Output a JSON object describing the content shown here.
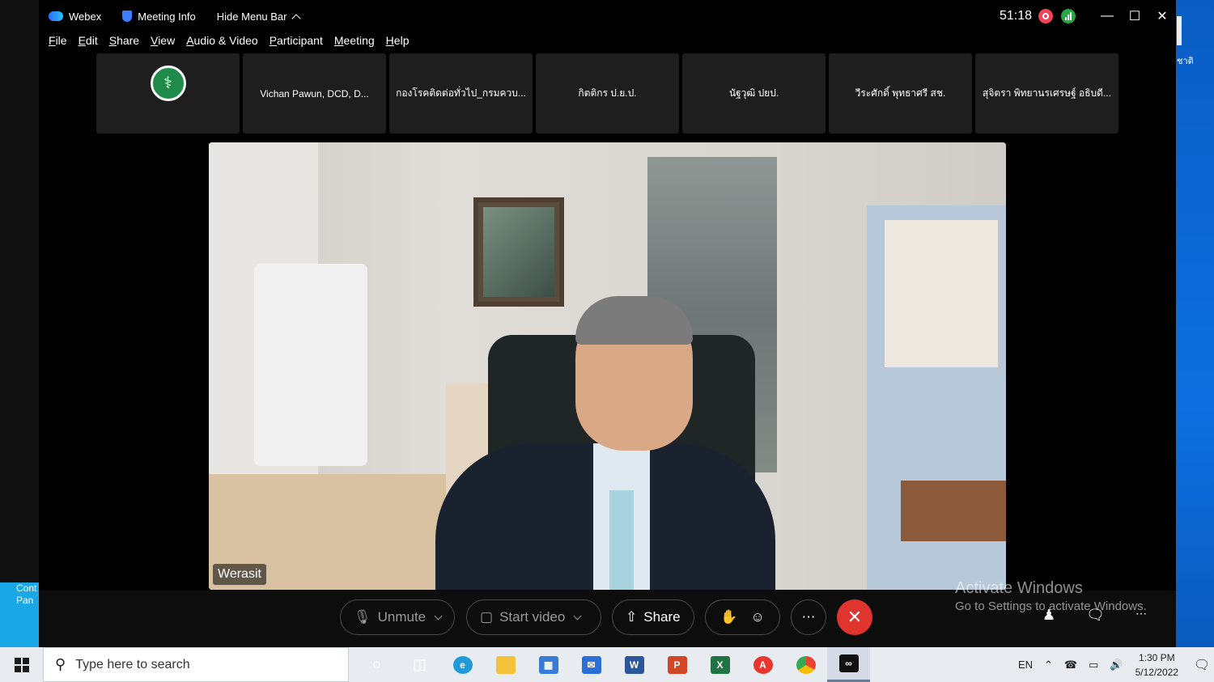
{
  "titlebar": {
    "app_name": "Webex",
    "meeting_info": "Meeting Info",
    "hide_menu": "Hide Menu Bar",
    "timer": "51:18"
  },
  "menu": [
    "File",
    "Edit",
    "Share",
    "View",
    "Audio & Video",
    "Participant",
    "Meeting",
    "Help"
  ],
  "participants": [
    "Vichan Pawun, DCD, D...",
    "กองโรคติดต่อทั่วไป_กรมควบ...",
    "กิตติกร ป.ย.ป.",
    "นัฐวุฒิ ปยป.",
    "วีระศักดิ์ พุทธาศรี สช.",
    "สุจิตรา พิทยานรเศรษฐ์ อธิบดี..."
  ],
  "active_speaker": "Werasit",
  "controls": {
    "unmute": "Unmute",
    "start_video": "Start video",
    "share": "Share"
  },
  "watermark": {
    "line1": "Activate Windows",
    "line2": "Go to Settings to activate Windows."
  },
  "desktop": {
    "left_label": "Cont Pan",
    "right_label": "ชาติ"
  },
  "taskbar": {
    "search_placeholder": "Type here to search",
    "lang": "EN",
    "time": "1:30 PM",
    "date": "5/12/2022"
  },
  "colors": {
    "record": "#f0435a",
    "signal": "#28a745",
    "end_call": "#e0342f"
  }
}
